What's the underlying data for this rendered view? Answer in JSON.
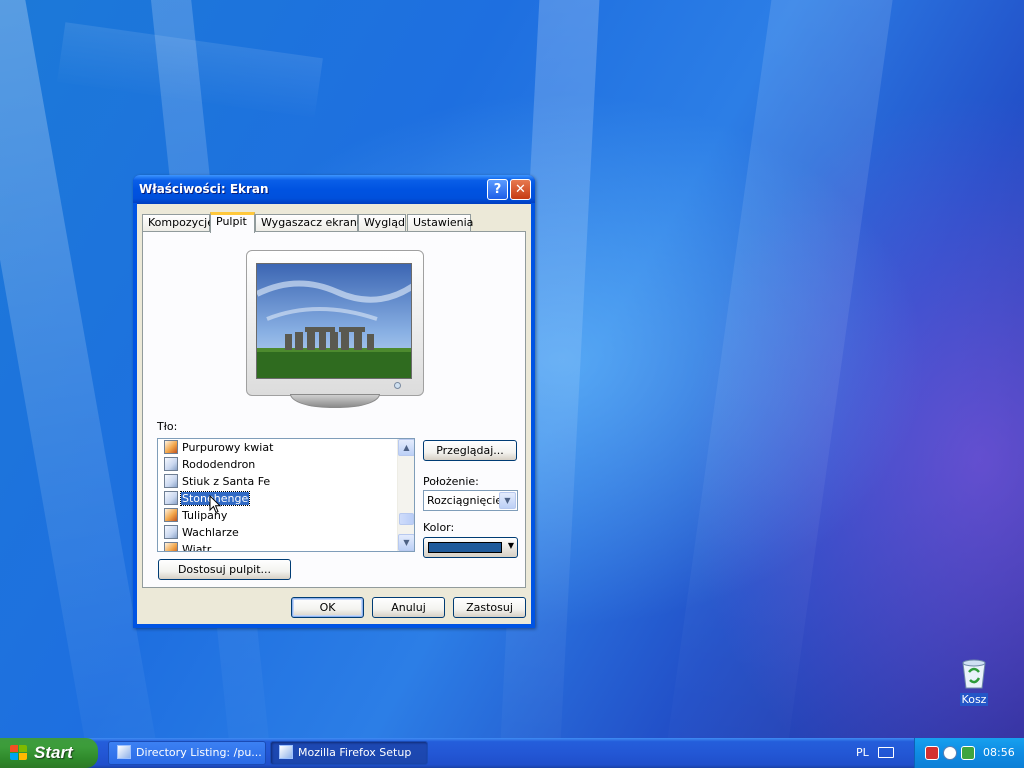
{
  "window": {
    "title": "Właściwości: Ekran",
    "help_glyph": "?",
    "close_glyph": "✕",
    "tabs": [
      {
        "label": "Kompozycje"
      },
      {
        "label": "Pulpit"
      },
      {
        "label": "Wygaszacz ekranu"
      },
      {
        "label": "Wygląd"
      },
      {
        "label": "Ustawienia"
      }
    ],
    "active_tab": "Pulpit",
    "background_label": "Tło:",
    "backgrounds": [
      {
        "label": "Purpurowy kwiat",
        "icon": "image-file-icon"
      },
      {
        "label": "Rododendron",
        "icon": "image-file-icon"
      },
      {
        "label": "Stiuk z Santa Fe",
        "icon": "image-file-icon"
      },
      {
        "label": "Stonehenge",
        "icon": "image-file-icon",
        "selected": true
      },
      {
        "label": "Tulipany",
        "icon": "image-file-icon"
      },
      {
        "label": "Wachlarze",
        "icon": "image-file-icon"
      },
      {
        "label": "Wiatr",
        "icon": "image-file-icon"
      }
    ],
    "browse_button": "Przeglądaj...",
    "position_label": "Położenie:",
    "position_value": "Rozciągnięcie",
    "color_label": "Kolor:",
    "color_value": "#1f5a9a",
    "customize_button": "Dostosuj pulpit...",
    "ok_button": "OK",
    "cancel_button": "Anuluj",
    "apply_button": "Zastosuj"
  },
  "desktop": {
    "recycle_bin_label": "Kosz"
  },
  "taskbar": {
    "start_label": "Start",
    "tasks": [
      {
        "label": "Directory Listing: /pu...",
        "icon": "folder-icon",
        "active": false
      },
      {
        "label": "Mozilla Firefox Setup",
        "icon": "setup-icon",
        "active": true
      }
    ],
    "language": "PL",
    "clock": "08:56"
  },
  "colors": {
    "titlebar": "#0053e1",
    "selection": "#316ac5",
    "start": "#3c9c3a",
    "tray": "#0f8be3"
  }
}
